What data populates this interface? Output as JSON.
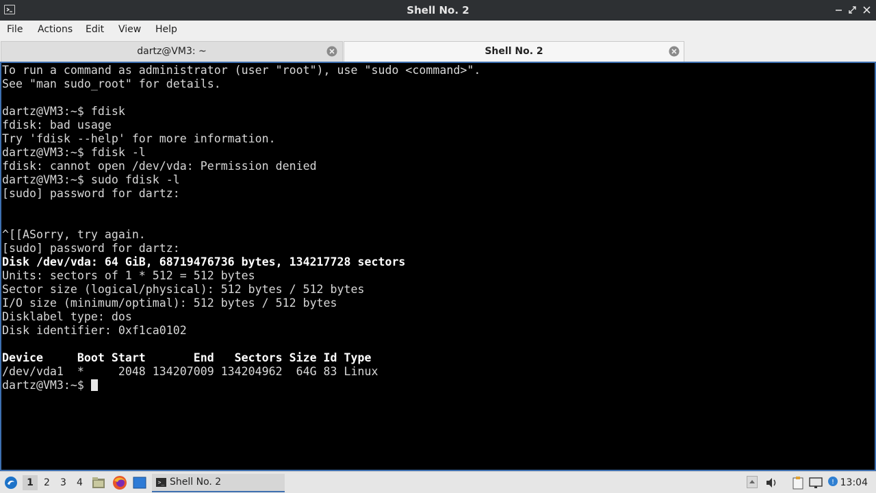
{
  "window": {
    "title": "Shell No. 2"
  },
  "menu": [
    "File",
    "Actions",
    "Edit",
    "View",
    "Help"
  ],
  "tabs": [
    {
      "label": "dartz@VM3: ~",
      "active": false
    },
    {
      "label": "Shell No. 2",
      "active": true
    }
  ],
  "terminal": {
    "lines": [
      {
        "text": "To run a command as administrator (user \"root\"), use \"sudo <command>\".",
        "bold": false
      },
      {
        "text": "See \"man sudo_root\" for details.",
        "bold": false
      },
      {
        "text": "",
        "bold": false
      },
      {
        "text": "dartz@VM3:~$ fdisk",
        "bold": false
      },
      {
        "text": "fdisk: bad usage",
        "bold": false
      },
      {
        "text": "Try 'fdisk --help' for more information.",
        "bold": false
      },
      {
        "text": "dartz@VM3:~$ fdisk -l",
        "bold": false
      },
      {
        "text": "fdisk: cannot open /dev/vda: Permission denied",
        "bold": false
      },
      {
        "text": "dartz@VM3:~$ sudo fdisk -l",
        "bold": false
      },
      {
        "text": "[sudo] password for dartz:",
        "bold": false
      },
      {
        "text": "",
        "bold": false
      },
      {
        "text": "",
        "bold": false
      },
      {
        "text": "^[[ASorry, try again.",
        "bold": false
      },
      {
        "text": "[sudo] password for dartz:",
        "bold": false
      },
      {
        "text": "Disk /dev/vda: 64 GiB, 68719476736 bytes, 134217728 sectors",
        "bold": true
      },
      {
        "text": "Units: sectors of 1 * 512 = 512 bytes",
        "bold": false
      },
      {
        "text": "Sector size (logical/physical): 512 bytes / 512 bytes",
        "bold": false
      },
      {
        "text": "I/O size (minimum/optimal): 512 bytes / 512 bytes",
        "bold": false
      },
      {
        "text": "Disklabel type: dos",
        "bold": false
      },
      {
        "text": "Disk identifier: 0xf1ca0102",
        "bold": false
      },
      {
        "text": "",
        "bold": false
      },
      {
        "text": "Device     Boot Start       End   Sectors Size Id Type",
        "bold": true
      },
      {
        "text": "/dev/vda1  *     2048 134207009 134204962  64G 83 Linux",
        "bold": false
      }
    ],
    "prompt": "dartz@VM3:~$ "
  },
  "taskbar": {
    "desktops": [
      "1",
      "2",
      "3",
      "4"
    ],
    "current_desktop": "1",
    "task_label": "Shell No. 2",
    "clock": "13:04"
  },
  "colors": {
    "accent": "#3d6fb0",
    "terminal_bg": "#000000",
    "terminal_fg": "#d8d8d8"
  }
}
